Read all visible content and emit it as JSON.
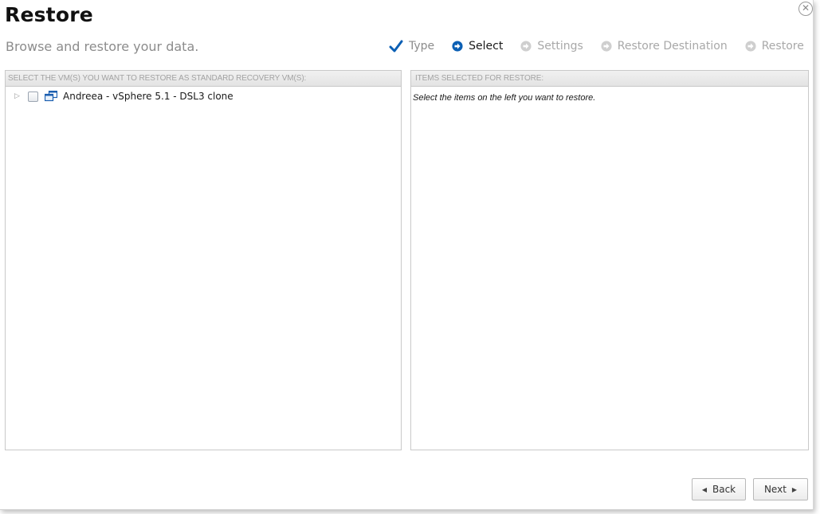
{
  "header": {
    "title": "Restore",
    "subtitle": "Browse and restore your data.",
    "close_glyph": "✕"
  },
  "steps": [
    {
      "label": "Type",
      "state": "done",
      "icon": "checkmark-icon"
    },
    {
      "label": "Select",
      "state": "current",
      "icon": "arrow-circle-icon"
    },
    {
      "label": "Settings",
      "state": "pending",
      "icon": "arrow-circle-icon"
    },
    {
      "label": "Restore Destination",
      "state": "pending",
      "icon": "arrow-circle-icon"
    },
    {
      "label": "Restore",
      "state": "pending",
      "icon": "arrow-circle-icon"
    }
  ],
  "left_panel": {
    "header": "SELECT THE VM(S) YOU WANT TO RESTORE AS STANDARD RECOVERY VM(S):",
    "tree": [
      {
        "label": "Andreea - vSphere 5.1 - DSL3 clone",
        "checked": false,
        "expanded": false,
        "icon": "vm-icon"
      }
    ]
  },
  "right_panel": {
    "header": "ITEMS SELECTED FOR RESTORE:",
    "hint": "Select the items on the left you want to restore."
  },
  "buttons": {
    "back": "Back",
    "next": "Next"
  },
  "colors": {
    "accent_blue": "#0b5fb4",
    "pending_gray": "#c4c4c4",
    "panel_border": "#c9c9c9"
  }
}
